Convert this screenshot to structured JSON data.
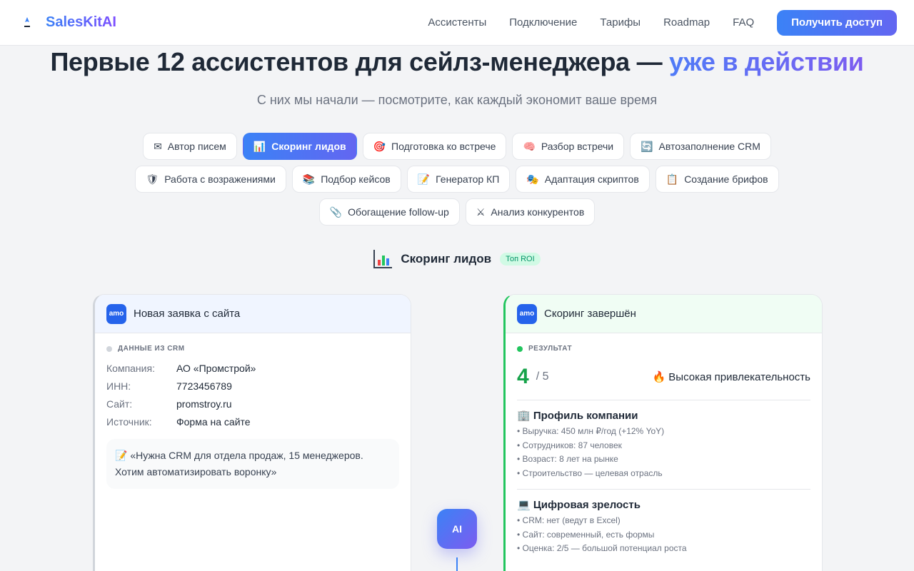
{
  "header": {
    "brand": "SalesKitAI",
    "nav": [
      "Ассистенты",
      "Подключение",
      "Тарифы",
      "Roadmap",
      "FAQ"
    ],
    "cta": "Получить доступ"
  },
  "hero": {
    "title": "Первые 12 ассистентов для сейлз-менеджера — ",
    "title_accent": "уже в действии",
    "subtitle": "С них мы начали — посмотрите, как каждый экономит ваше время"
  },
  "chips": [
    {
      "icon": "envelope-icon",
      "glyph": "✉",
      "label": "Автор писем",
      "active": false
    },
    {
      "icon": "bar-chart-icon",
      "glyph": "📊",
      "label": "Скоринг лидов",
      "active": true
    },
    {
      "icon": "target-icon",
      "glyph": "🎯",
      "label": "Подготовка ко встрече",
      "active": false
    },
    {
      "icon": "brain-icon",
      "glyph": "🧠",
      "label": "Разбор встречи",
      "active": false
    },
    {
      "icon": "sync-icon",
      "glyph": "🔄",
      "label": "Автозаполнение CRM",
      "active": false
    },
    {
      "icon": "shield-icon",
      "glyph": "🛡",
      "label": "Работа с возражениями",
      "active": false
    },
    {
      "icon": "books-icon",
      "glyph": "📚",
      "label": "Подбор кейсов",
      "active": false
    },
    {
      "icon": "memo-icon",
      "glyph": "📝",
      "label": "Генератор КП",
      "active": false
    },
    {
      "icon": "masks-icon",
      "glyph": "🎭",
      "label": "Адаптация скриптов",
      "active": false
    },
    {
      "icon": "clipboard-icon",
      "glyph": "📋",
      "label": "Создание брифов",
      "active": false
    },
    {
      "icon": "paperclip-icon",
      "glyph": "📎",
      "label": "Обогащение follow-up",
      "active": false
    },
    {
      "icon": "swords-icon",
      "glyph": "⚔",
      "label": "Анализ конкурентов",
      "active": false
    }
  ],
  "section": {
    "icon": "bar-chart-icon",
    "title": "Скоринг лидов",
    "badge": "Топ ROI"
  },
  "left_card": {
    "app_badge": "amo",
    "title": "Новая заявка с сайта",
    "caption": "ДАННЫЕ ИЗ CRM",
    "fields": [
      {
        "k": "Компания:",
        "v": "АО «Промстрой»"
      },
      {
        "k": "ИНН:",
        "v": "7723456789"
      },
      {
        "k": "Сайт:",
        "v": "promstroy.ru"
      },
      {
        "k": "Источник:",
        "v": "Форма на сайте"
      }
    ],
    "quote": "📝 «Нужна CRM для отдела продаж, 15 менеджеров. Хотим автоматизировать воронку»"
  },
  "right_card": {
    "app_badge": "amo",
    "title": "Скоринг завершён",
    "caption": "РЕЗУЛЬТАТ",
    "score": "4",
    "score_of": "/ 5",
    "verdict": "🔥 Высокая привлекательность",
    "blocks": [
      {
        "title": "🏢 Профиль компании",
        "items": [
          "• Выручка: 450 млн ₽/год (+12% YoY)",
          "• Сотрудников: 87 человек",
          "• Возраст: 8 лет на рынке",
          "• Строительство — целевая отрасль"
        ]
      },
      {
        "title": "💻 Цифровая зрелость",
        "items": [
          "• CRM: нет (ведут в Excel)",
          "• Сайт: современный, есть формы",
          "• Оценка: 2/5 — большой потенциал роста"
        ]
      }
    ]
  },
  "ai_node": {
    "label": "AI"
  },
  "colors": {
    "accent": "#3b82f6",
    "accent2": "#7c5cf0",
    "success": "#22c55e"
  }
}
